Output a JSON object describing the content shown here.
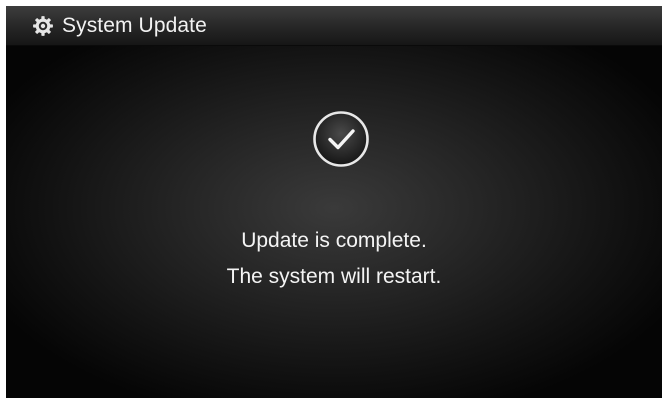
{
  "header": {
    "icon": "gear-icon",
    "title": "System Update"
  },
  "status": {
    "icon": "checkmark-circle-icon",
    "line1": "Update is complete.",
    "line2": "The system will restart."
  }
}
